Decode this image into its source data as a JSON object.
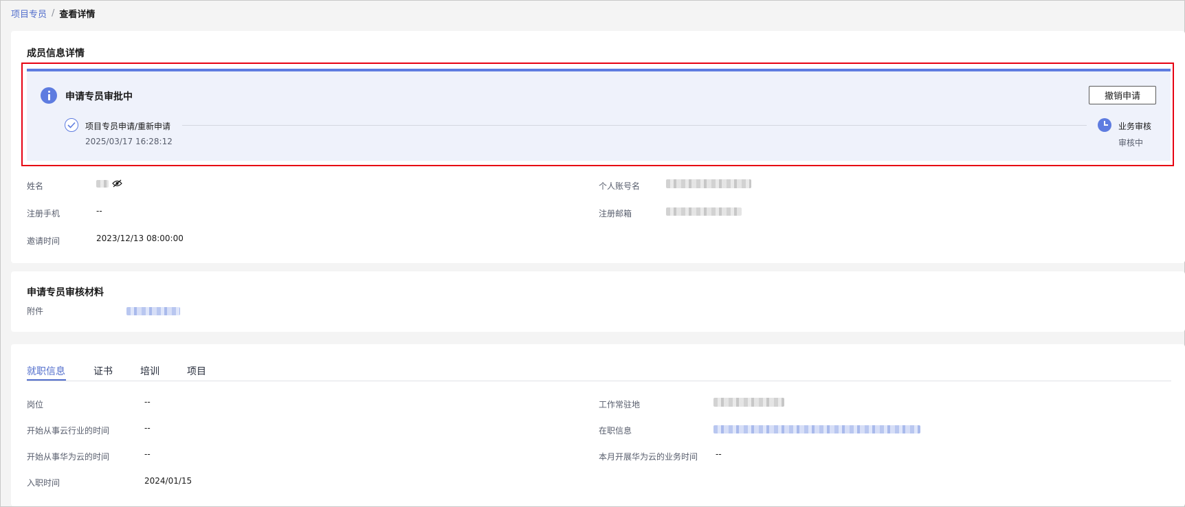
{
  "breadcrumb": {
    "parent": "项目专员",
    "separator": "/",
    "current": "查看详情"
  },
  "member": {
    "title": "成员信息详情",
    "approval": {
      "status_title": "申请专员审批中",
      "cancel_label": "撤销申请",
      "step1_label": "项目专员申请/重新申请",
      "step1_time": "2025/03/17 16:28:12",
      "step2_label": "业务审核",
      "step2_status": "审核中"
    },
    "fields": {
      "name_label": "姓名",
      "account_label": "个人账号名",
      "phone_label": "注册手机",
      "phone_value": "--",
      "email_label": "注册邮箱",
      "invite_label": "邀请时间",
      "invite_value": "2023/12/13 08:00:00"
    }
  },
  "materials": {
    "title": "申请专员审核材料",
    "attachment_label": "附件"
  },
  "tabs": [
    {
      "label": "就职信息",
      "active": true
    },
    {
      "label": "证书",
      "active": false
    },
    {
      "label": "培训",
      "active": false
    },
    {
      "label": "项目",
      "active": false
    }
  ],
  "employment": {
    "position_label": "岗位",
    "position_value": "--",
    "cloud_industry_label": "开始从事云行业的时间",
    "cloud_industry_value": "--",
    "huawei_cloud_label": "开始从事华为云的时间",
    "huawei_cloud_value": "--",
    "join_label": "入职时间",
    "join_value": "2024/01/15",
    "workplace_label": "工作常驻地",
    "onjob_label": "在职信息",
    "monthly_label": "本月开展华为云的业务时间",
    "monthly_value": "--"
  },
  "colors": {
    "accent": "#5e7ce0",
    "link": "#526ecc",
    "highlight_frame": "#e60012",
    "banner_bg": "#eff2fb"
  }
}
